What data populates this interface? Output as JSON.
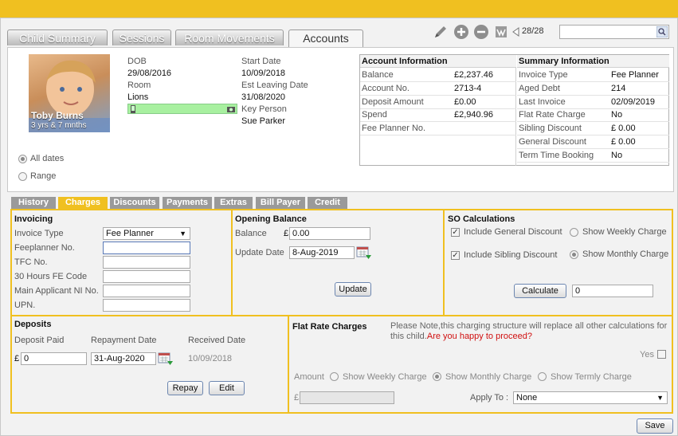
{
  "tabs": [
    "Child Summary",
    "Sessions",
    "Room Movements",
    "Accounts"
  ],
  "toolbar": {
    "record": "28/28",
    "search_value": ""
  },
  "child": {
    "name": "Toby Burns",
    "age": "3 yrs & 7 mnths"
  },
  "profile": {
    "dob_label": "DOB",
    "dob": "29/08/2016",
    "room_label": "Room",
    "room": "Lions",
    "start_label": "Start Date",
    "start": "10/09/2018",
    "leaving_label": "Est Leaving Date",
    "leaving": "31/08/2020",
    "key_label": "Key Person",
    "key": "Sue Parker"
  },
  "date_filter": {
    "all": "All dates",
    "range": "Range"
  },
  "account_info": {
    "title": "Account Information",
    "rows": [
      {
        "label": "Balance",
        "value": "£2,237.46"
      },
      {
        "label": "Account No.",
        "value": "2713-4"
      },
      {
        "label": "Deposit Amount",
        "value": "£0.00"
      },
      {
        "label": "Spend",
        "value": "£2,940.96"
      },
      {
        "label": "Fee Planner No.",
        "value": ""
      }
    ]
  },
  "summary_info": {
    "title": "Summary Information",
    "rows": [
      {
        "label": "Invoice Type",
        "value": "Fee Planner"
      },
      {
        "label": "Aged Debt",
        "value": "214"
      },
      {
        "label": "Last Invoice",
        "value": "02/09/2019"
      },
      {
        "label": "Flat Rate Charge",
        "value": "No"
      },
      {
        "label": "Sibling Discount",
        "value": "£ 0.00"
      },
      {
        "label": "General Discount",
        "value": "£ 0.00"
      },
      {
        "label": "Term Time Booking",
        "value": "No"
      }
    ]
  },
  "subtabs": [
    "History",
    "Charges",
    "Discounts",
    "Payments",
    "Extras",
    "Bill Payer",
    "Credit"
  ],
  "invoicing": {
    "title": "Invoicing",
    "invoice_type_label": "Invoice Type",
    "invoice_type": "Fee Planner",
    "feeplanner_label": "Feeplanner No.",
    "feeplanner": "",
    "tfc_label": "TFC No.",
    "tfc": "",
    "fe_label": "30 Hours FE Code",
    "fe": "",
    "ni_label": "Main Applicant NI No.",
    "ni": "",
    "upn_label": "UPN.",
    "upn": ""
  },
  "opening_balance": {
    "title": "Opening Balance",
    "balance_label": "Balance",
    "currency": "£",
    "balance": "0.00",
    "update_date_label": "Update Date",
    "update_date": "8-Aug-2019",
    "update_button": "Update"
  },
  "so_calc": {
    "title": "SO Calculations",
    "general_discount": "Include General Discount",
    "sibling_discount": "Include Sibling Discount",
    "weekly": "Show Weekly Charge",
    "monthly": "Show Monthly Charge",
    "calculate_button": "Calculate",
    "calc_value": "0"
  },
  "deposits": {
    "title": "Deposits",
    "paid_label": "Deposit Paid",
    "currency": "£",
    "paid": "0",
    "repay_label": "Repayment Date",
    "repay_date": "31-Aug-2020",
    "received_label": "Received Date",
    "received_date": "10/09/2018",
    "repay_button": "Repay",
    "edit_button": "Edit"
  },
  "flat_rate": {
    "title": "Flat Rate Charges",
    "note": "Please Note,this charging structure will replace all other calculations for this child.",
    "warning": "Are you happy to proceed?",
    "yes_label": "Yes",
    "amount_label": "Amount",
    "weekly": "Show Weekly Charge",
    "monthly": "Show Monthly Charge",
    "termly": "Show Termly Charge",
    "currency": "£",
    "apply_label": "Apply To :",
    "apply_value": "None"
  },
  "save_button": "Save"
}
